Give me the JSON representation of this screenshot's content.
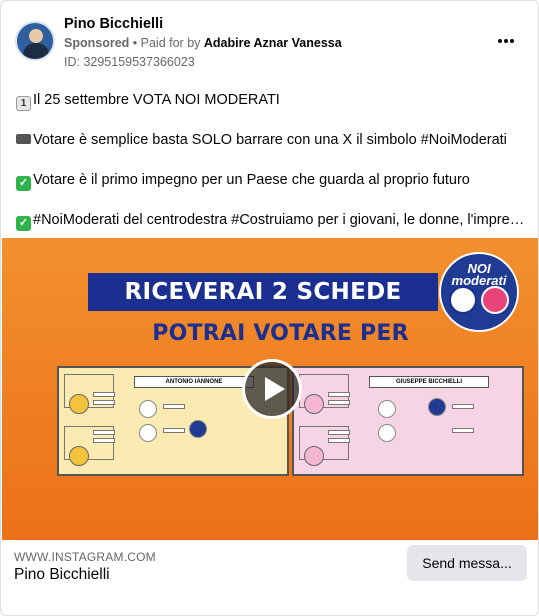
{
  "post": {
    "page_name": "Pino Bicchielli",
    "sponsored_label": "Sponsored",
    "paid_for_prefix": "Paid for by",
    "paid_for_name": "Adabire Aznar Vanessa",
    "ad_id": "ID: 3295159537366023",
    "lines": [
      {
        "emoji": "1",
        "text": "Il 25 settembre VOTA NOI MODERATI"
      },
      {
        "emoji": "ballot-box-icon",
        "text": "Votare è semplice basta SOLO barrare con una X il simbolo #NoiModerati"
      },
      {
        "emoji": "check-icon",
        "text": "Votare è il primo impegno per un Paese che guarda al proprio futuro"
      },
      {
        "emoji": "check-icon",
        "text": "#NoiModerati del centrodestra #Costruiamo per i giovani, le donne, l'impresa, i..."
      }
    ]
  },
  "media": {
    "headline1": "RICEVERAI 2 SCHEDE",
    "headline2": "POTRAI VOTARE PER",
    "logo_text": "NOI moderati",
    "left_ballot_name": "ANTONIO IANNONE",
    "right_ballot_name": "GIUSEPPE BICCHIELLI",
    "colors": {
      "background": "#ef7d20",
      "banner": "#1a2f8f",
      "left_ballot": "#fbeab2",
      "right_ballot": "#f7d4e4"
    }
  },
  "footer": {
    "domain": "WWW.INSTAGRAM.COM",
    "link_title": "Pino Bicchielli",
    "cta_label": "Send messa..."
  }
}
